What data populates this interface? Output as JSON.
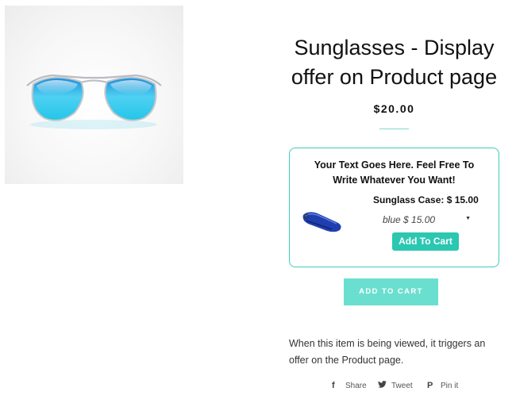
{
  "product": {
    "title_line1": "Sunglasses - Display",
    "title_line2": "offer on Product page",
    "price": "$20.00",
    "add_to_cart": "ADD TO CART",
    "description_line1": "When this item is being viewed, it triggers an",
    "description_line2": "offer on the Product page."
  },
  "offer": {
    "headline_line1": "Your Text Goes Here. Feel Free To",
    "headline_line2": "Write Whatever You Want!",
    "item_title": "Sunglass Case: $ 15.00",
    "variant_selected": "blue $ 15.00",
    "button_label": "Add To Cart"
  },
  "share": {
    "facebook": {
      "icon": "facebook-icon",
      "label": "Share"
    },
    "twitter": {
      "icon": "twitter-icon",
      "label": "Tweet"
    },
    "pinterest": {
      "icon": "pinterest-icon",
      "label": "Pin it"
    }
  },
  "colors": {
    "accent": "#2bc7b1",
    "add_to_cart_bg": "#6bdfcf",
    "lens": "#2ab8e6",
    "case": "#1f3fb0"
  }
}
